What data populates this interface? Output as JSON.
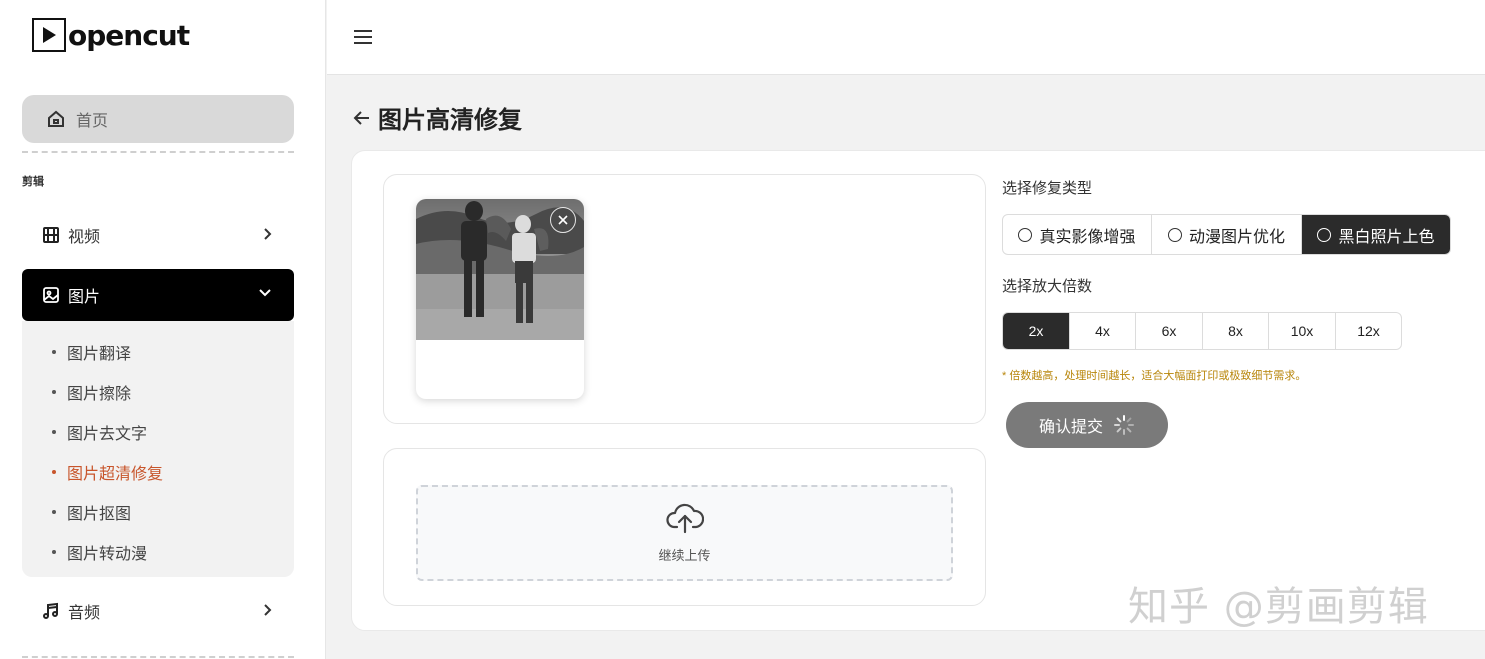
{
  "app": {
    "logo_text": "opencut"
  },
  "sidebar": {
    "home_label": "首页",
    "section_label": "剪辑",
    "items": [
      {
        "label": "视频",
        "icon": "film-icon"
      },
      {
        "label": "图片",
        "icon": "image-icon"
      },
      {
        "label": "音频",
        "icon": "music-icon"
      }
    ],
    "image_submenu": [
      "图片翻译",
      "图片擦除",
      "图片去文字",
      "图片超清修复",
      "图片抠图",
      "图片转动漫"
    ],
    "current_submenu": "图片超清修复"
  },
  "page": {
    "title": "图片高清修复"
  },
  "upload": {
    "label": "继续上传"
  },
  "options": {
    "repair_type_label": "选择修复类型",
    "repair_types": [
      "真实影像增强",
      "动漫图片优化",
      "黑白照片上色"
    ],
    "repair_type_selected": "黑白照片上色",
    "scale_label": "选择放大倍数",
    "scales": [
      "2x",
      "4x",
      "6x",
      "8x",
      "10x",
      "12x"
    ],
    "scale_selected": "2x",
    "hint": "* 倍数越高，处理时间越长，适合大幅面打印或极致细节需求。"
  },
  "submit": {
    "label": "确认提交"
  },
  "watermark": "知乎 @剪画剪辑",
  "colors": {
    "active": "#000000",
    "current_submenu": "#c8552b",
    "hint": "#b8860b",
    "submit_bg": "#7a7a7a",
    "selected_option": "#2b2b2b"
  }
}
